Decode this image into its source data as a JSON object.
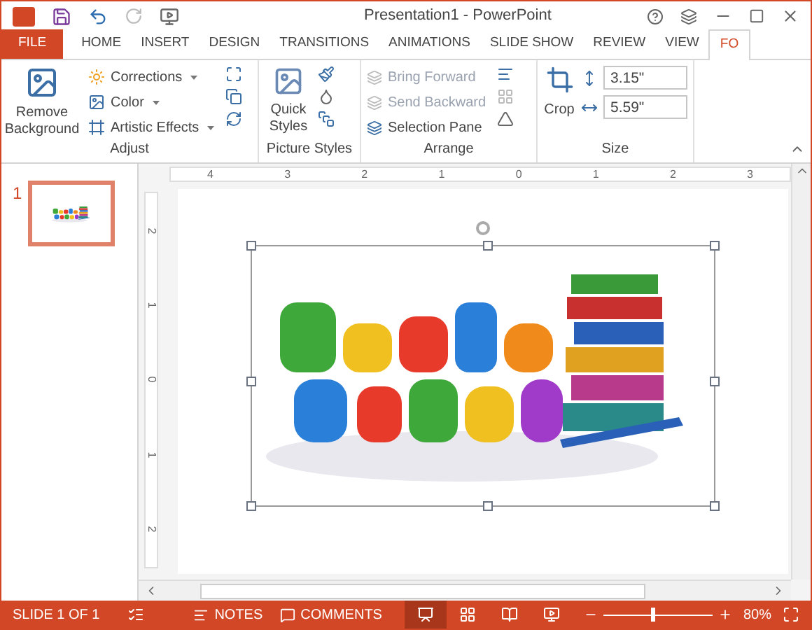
{
  "window": {
    "title": "Presentation1 - PowerPoint"
  },
  "tabs": [
    {
      "label": "FILE",
      "kind": "file",
      "selected": false
    },
    {
      "label": "HOME",
      "kind": "tab",
      "selected": false
    },
    {
      "label": "INSERT",
      "kind": "tab",
      "selected": false
    },
    {
      "label": "DESIGN",
      "kind": "tab",
      "selected": false
    },
    {
      "label": "TRANSITIONS",
      "kind": "tab",
      "selected": false
    },
    {
      "label": "ANIMATIONS",
      "kind": "tab",
      "selected": false
    },
    {
      "label": "SLIDE SHOW",
      "kind": "tab",
      "selected": false
    },
    {
      "label": "REVIEW",
      "kind": "tab",
      "selected": false
    },
    {
      "label": "VIEW",
      "kind": "tab",
      "selected": false
    },
    {
      "label": "FO",
      "kind": "tab",
      "selected": true
    }
  ],
  "adjust": {
    "label": "Adjust",
    "remove_background": "Remove Background",
    "buttons": [
      {
        "label": "Corrections",
        "disabled": false
      },
      {
        "label": "Color",
        "disabled": false
      },
      {
        "label": "Artistic Effects",
        "disabled": false
      }
    ]
  },
  "picture_styles": {
    "label": "Picture Styles",
    "quick_styles": "Quick Styles"
  },
  "arrange": {
    "label": "Arrange",
    "buttons": [
      {
        "label": "Bring Forward",
        "disabled": true
      },
      {
        "label": "Send Backward",
        "disabled": true
      },
      {
        "label": "Selection Pane",
        "disabled": false
      }
    ]
  },
  "size": {
    "label": "Size",
    "crop": "Crop",
    "height": "3.15\"",
    "width": "5.59\""
  },
  "slides": [
    {
      "number": "1",
      "selected": true
    }
  ],
  "ruler": {
    "horizontal": [
      "4",
      "3",
      "2",
      "1",
      "0",
      "1",
      "2",
      "3"
    ],
    "vertical": [
      "2",
      "1",
      "0",
      "1",
      "2"
    ]
  },
  "status_bar": {
    "slide": "SLIDE 1 OF 1",
    "notes": "NOTES",
    "comments": "COMMENTS",
    "views": [
      {
        "selected": true
      },
      {
        "selected": false
      },
      {
        "selected": false
      },
      {
        "selected": false
      }
    ],
    "zoom": {
      "level": 0.43,
      "reading": "80%"
    }
  }
}
